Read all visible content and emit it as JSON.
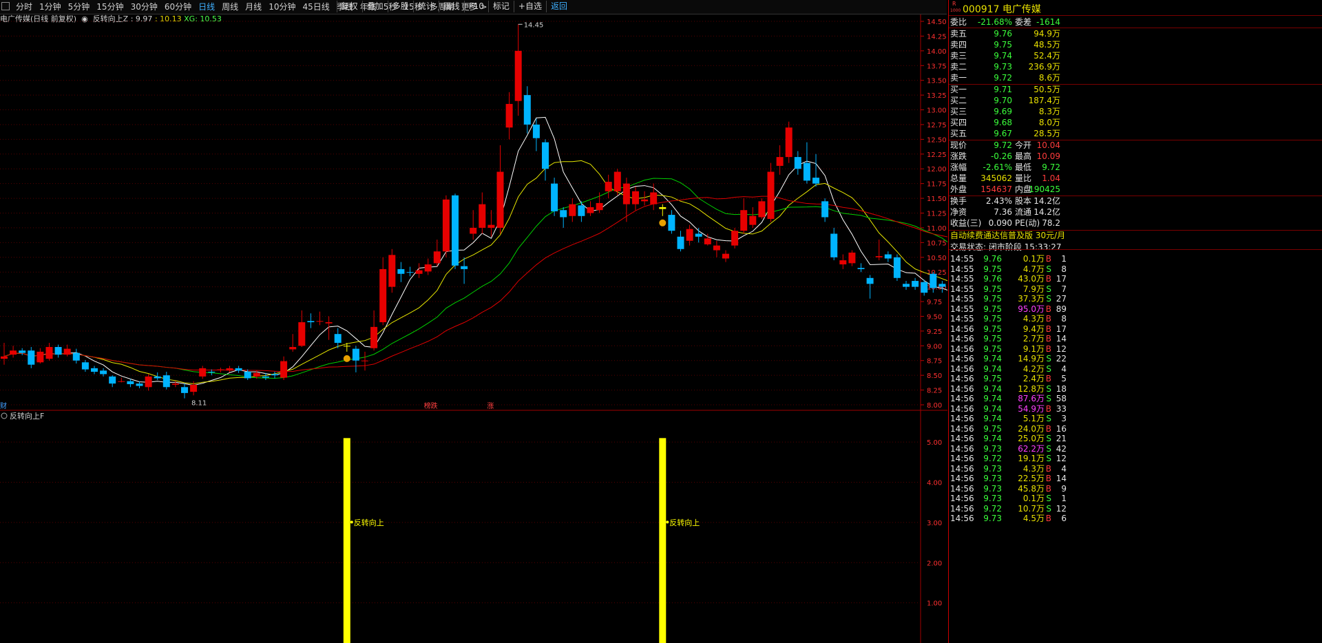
{
  "toolbar": {
    "periods": [
      "分时",
      "1分钟",
      "5分钟",
      "15分钟",
      "30分钟",
      "60分钟",
      "日线",
      "周线",
      "月线",
      "10分钟",
      "45日线",
      "季线",
      "年线",
      "5秒",
      "15秒",
      "多周期",
      "更多 >"
    ],
    "active_period": "日线",
    "tools": [
      "复权",
      "叠加",
      "多股",
      "统计",
      "画线",
      "F10",
      "标记",
      "+自选",
      "返回"
    ],
    "highlight_tool": "返回"
  },
  "indicator_line": {
    "stock": "电广传媒(日线 前复权)",
    "name": "反转向上Z",
    "v1": ": 9.97",
    "v2": ": 10.13",
    "v3": "XG: 10.53"
  },
  "chart": {
    "high_label": "14.45",
    "low_label": "8.11",
    "event_labels": [
      "财",
      "榜跌",
      "涨"
    ],
    "price_ticks": [
      "14.50",
      "14.25",
      "14.00",
      "13.75",
      "13.50",
      "13.25",
      "13.00",
      "12.75",
      "12.50",
      "12.25",
      "12.00",
      "11.75",
      "11.50",
      "11.25",
      "11.00",
      "10.75",
      "10.50",
      "10.25",
      "10.00",
      "9.75",
      "9.50",
      "9.25",
      "9.00",
      "8.75",
      "8.50",
      "8.25",
      "8.00"
    ],
    "sub_name": "反转向上F",
    "sub_ticks": [
      "5.00",
      "4.00",
      "3.00",
      "2.00",
      "1.00"
    ],
    "signal_label": "反转向上",
    "colors": {
      "up": "#e60000",
      "down": "#00b4ff",
      "ma5": "#ffffff",
      "ma10": "#e6e600",
      "ma20": "#00d000",
      "ma30": "#e00000",
      "signal": "#ffff00"
    }
  },
  "quote": {
    "code": "000917",
    "name": "电广传媒",
    "badge": "R",
    "weibi_label": "委比",
    "weibi": "-21.68%",
    "weicha_label": "委差",
    "weicha": "-1614",
    "asks": [
      {
        "label": "卖五",
        "price": "9.76",
        "vol": "94.9万"
      },
      {
        "label": "卖四",
        "price": "9.75",
        "vol": "48.5万"
      },
      {
        "label": "卖三",
        "price": "9.74",
        "vol": "52.4万"
      },
      {
        "label": "卖二",
        "price": "9.73",
        "vol": "236.9万"
      },
      {
        "label": "卖一",
        "price": "9.72",
        "vol": "8.6万"
      }
    ],
    "bids": [
      {
        "label": "买一",
        "price": "9.71",
        "vol": "50.5万"
      },
      {
        "label": "买二",
        "price": "9.70",
        "vol": "187.4万"
      },
      {
        "label": "买三",
        "price": "9.69",
        "vol": "8.3万"
      },
      {
        "label": "买四",
        "price": "9.68",
        "vol": "8.0万"
      },
      {
        "label": "买五",
        "price": "9.67",
        "vol": "28.5万"
      }
    ],
    "stats": [
      {
        "l1": "现价",
        "v1": "9.72",
        "l2": "今开",
        "v2": "10.04"
      },
      {
        "l1": "涨跌",
        "v1": "-0.26",
        "l2": "最高",
        "v2": "10.09"
      },
      {
        "l1": "涨幅",
        "v1": "-2.61%",
        "l2": "最低",
        "v2": "9.72"
      },
      {
        "l1": "总量",
        "v1": "345062",
        "l2": "量比",
        "v2": "1.04"
      },
      {
        "l1": "外盘",
        "v1": "154637",
        "l2": "内盘",
        "v2": "190425"
      }
    ],
    "fund": [
      {
        "l1": "换手",
        "v1": "2.43%",
        "l2": "股本",
        "v2": "14.2亿"
      },
      {
        "l1": "净资",
        "v1": "7.36",
        "l2": "流通",
        "v2": "14.2亿"
      },
      {
        "l1": "收益(三)",
        "v1": "0.090",
        "l2": "PE(动)",
        "v2": "78.2"
      }
    ],
    "ad": "自动续费通达信普及版  30元/月",
    "status": "交易状态: 闭市阶段 15:33:27"
  },
  "ticks": [
    {
      "t": "14:55",
      "p": "9.76",
      "v": "0.1万",
      "s": "B",
      "n": "1"
    },
    {
      "t": "14:55",
      "p": "9.75",
      "v": "4.7万",
      "s": "S",
      "n": "8"
    },
    {
      "t": "14:55",
      "p": "9.76",
      "v": "43.0万",
      "s": "B",
      "n": "17"
    },
    {
      "t": "14:55",
      "p": "9.75",
      "v": "7.9万",
      "s": "S",
      "n": "7"
    },
    {
      "t": "14:55",
      "p": "9.75",
      "v": "37.3万",
      "s": "S",
      "n": "27"
    },
    {
      "t": "14:55",
      "p": "9.75",
      "v": "95.0万",
      "s": "B",
      "n": "89"
    },
    {
      "t": "14:55",
      "p": "9.75",
      "v": "4.3万",
      "s": "B",
      "n": "8"
    },
    {
      "t": "14:56",
      "p": "9.75",
      "v": "9.4万",
      "s": "B",
      "n": "17"
    },
    {
      "t": "14:56",
      "p": "9.75",
      "v": "2.7万",
      "s": "B",
      "n": "14"
    },
    {
      "t": "14:56",
      "p": "9.75",
      "v": "9.1万",
      "s": "B",
      "n": "12"
    },
    {
      "t": "14:56",
      "p": "9.74",
      "v": "14.9万",
      "s": "S",
      "n": "22"
    },
    {
      "t": "14:56",
      "p": "9.74",
      "v": "4.2万",
      "s": "S",
      "n": "4"
    },
    {
      "t": "14:56",
      "p": "9.75",
      "v": "2.4万",
      "s": "B",
      "n": "5"
    },
    {
      "t": "14:56",
      "p": "9.74",
      "v": "12.8万",
      "s": "S",
      "n": "18"
    },
    {
      "t": "14:56",
      "p": "9.74",
      "v": "87.6万",
      "s": "S",
      "n": "58"
    },
    {
      "t": "14:56",
      "p": "9.74",
      "v": "54.9万",
      "s": "B",
      "n": "33"
    },
    {
      "t": "14:56",
      "p": "9.74",
      "v": "5.1万",
      "s": "S",
      "n": "3"
    },
    {
      "t": "14:56",
      "p": "9.75",
      "v": "24.0万",
      "s": "B",
      "n": "16"
    },
    {
      "t": "14:56",
      "p": "9.74",
      "v": "25.0万",
      "s": "S",
      "n": "21"
    },
    {
      "t": "14:56",
      "p": "9.73",
      "v": "62.2万",
      "s": "S",
      "n": "42"
    },
    {
      "t": "14:56",
      "p": "9.72",
      "v": "19.1万",
      "s": "S",
      "n": "12"
    },
    {
      "t": "14:56",
      "p": "9.73",
      "v": "4.3万",
      "s": "B",
      "n": "4"
    },
    {
      "t": "14:56",
      "p": "9.73",
      "v": "22.5万",
      "s": "B",
      "n": "14"
    },
    {
      "t": "14:56",
      "p": "9.73",
      "v": "45.8万",
      "s": "B",
      "n": "9"
    },
    {
      "t": "14:56",
      "p": "9.73",
      "v": "0.1万",
      "s": "S",
      "n": "1"
    },
    {
      "t": "14:56",
      "p": "9.72",
      "v": "10.7万",
      "s": "S",
      "n": "12"
    },
    {
      "t": "14:56",
      "p": "9.73",
      "v": "4.5万",
      "s": "B",
      "n": "6"
    }
  ],
  "chart_data": {
    "type": "candlestick",
    "ylim": [
      8.0,
      14.5
    ],
    "candles": [
      [
        8.78,
        8.82,
        9.05,
        8.68
      ],
      [
        8.85,
        8.92,
        9.0,
        8.8
      ],
      [
        8.92,
        8.88,
        8.96,
        8.84
      ],
      [
        8.92,
        8.68,
        8.98,
        8.62
      ],
      [
        8.72,
        8.9,
        8.96,
        8.7
      ],
      [
        8.78,
        8.98,
        9.05,
        8.75
      ],
      [
        8.98,
        8.85,
        9.02,
        8.8
      ],
      [
        8.85,
        8.95,
        9.02,
        8.82
      ],
      [
        8.88,
        8.75,
        8.95,
        8.7
      ],
      [
        8.72,
        8.6,
        8.76,
        8.56
      ],
      [
        8.62,
        8.56,
        8.66,
        8.52
      ],
      [
        8.58,
        8.52,
        8.62,
        8.48
      ],
      [
        8.48,
        8.36,
        8.5,
        8.3
      ],
      [
        8.4,
        8.4,
        8.46,
        8.38
      ],
      [
        8.4,
        8.35,
        8.44,
        8.3
      ],
      [
        8.36,
        8.32,
        8.4,
        8.28
      ],
      [
        8.3,
        8.48,
        8.52,
        8.24
      ],
      [
        8.48,
        8.45,
        8.55,
        8.42
      ],
      [
        8.5,
        8.3,
        8.56,
        8.26
      ],
      [
        8.34,
        8.36,
        8.4,
        8.3
      ],
      [
        8.3,
        8.2,
        8.36,
        8.11
      ],
      [
        8.22,
        8.34,
        8.4,
        8.16
      ],
      [
        8.48,
        8.62,
        8.66,
        8.44
      ],
      [
        8.56,
        8.55,
        8.6,
        8.5
      ],
      [
        8.6,
        8.6,
        8.63,
        8.55
      ],
      [
        8.58,
        8.62,
        8.66,
        8.55
      ],
      [
        8.62,
        8.58,
        8.66,
        8.54
      ],
      [
        8.56,
        8.45,
        8.6,
        8.42
      ],
      [
        8.48,
        8.54,
        8.58,
        8.44
      ],
      [
        8.48,
        8.46,
        8.54,
        8.42
      ],
      [
        8.52,
        8.5,
        8.56,
        8.45
      ],
      [
        8.46,
        8.74,
        8.82,
        8.42
      ],
      [
        8.94,
        8.98,
        9.2,
        8.9
      ],
      [
        9.0,
        9.4,
        9.6,
        8.98
      ],
      [
        9.42,
        9.4,
        9.55,
        9.3
      ],
      [
        9.42,
        9.42,
        9.58,
        9.35
      ],
      [
        9.38,
        9.4,
        9.5,
        9.1
      ],
      [
        9.2,
        9.05,
        9.3,
        8.96
      ],
      [
        9.0,
        9.0,
        9.05,
        8.9
      ],
      [
        8.95,
        8.75,
        9.0,
        8.55
      ],
      [
        8.75,
        8.75,
        8.9,
        8.58
      ],
      [
        8.96,
        9.32,
        9.6,
        8.92
      ],
      [
        9.4,
        10.3,
        10.5,
        9.35
      ],
      [
        10.0,
        10.54,
        10.64,
        9.9
      ],
      [
        10.3,
        10.22,
        10.42,
        10.08
      ],
      [
        10.25,
        10.24,
        10.34,
        10.18
      ],
      [
        10.22,
        10.28,
        10.4,
        10.15
      ],
      [
        10.26,
        10.38,
        10.48,
        10.2
      ],
      [
        10.4,
        10.6,
        10.8,
        10.35
      ],
      [
        10.6,
        11.48,
        11.55,
        10.5
      ],
      [
        11.55,
        10.36,
        11.58,
        10.3
      ],
      [
        10.35,
        10.3,
        10.5,
        10.05
      ],
      [
        10.9,
        11.0,
        11.3,
        10.8
      ],
      [
        11.0,
        11.4,
        11.6,
        10.9
      ],
      [
        11.0,
        11.05,
        11.3,
        10.85
      ],
      [
        11.0,
        11.95,
        12.4,
        10.9
      ],
      [
        12.7,
        13.1,
        13.3,
        12.5
      ],
      [
        13.15,
        14.0,
        14.45,
        12.9
      ],
      [
        13.25,
        12.75,
        13.4,
        12.6
      ],
      [
        12.75,
        12.52,
        12.85,
        12.3
      ],
      [
        12.45,
        12.0,
        12.5,
        11.8
      ],
      [
        11.75,
        11.28,
        11.85,
        11.2
      ],
      [
        11.3,
        11.18,
        11.35,
        11.0
      ],
      [
        11.2,
        11.4,
        11.5,
        11.1
      ],
      [
        11.38,
        11.2,
        11.45,
        11.1
      ],
      [
        11.25,
        11.35,
        11.45,
        11.2
      ],
      [
        11.3,
        11.42,
        11.6,
        11.25
      ],
      [
        11.62,
        11.78,
        11.9,
        11.5
      ],
      [
        11.62,
        11.95,
        12.0,
        11.55
      ],
      [
        11.4,
        11.75,
        11.85,
        11.1
      ],
      [
        11.4,
        11.62,
        11.7,
        11.3
      ],
      [
        11.45,
        11.48,
        11.62,
        11.38
      ],
      [
        11.4,
        11.6,
        11.75,
        11.3
      ],
      [
        11.35,
        11.32,
        11.4,
        11.2
      ],
      [
        11.22,
        10.95,
        11.3,
        10.9
      ],
      [
        10.85,
        10.64,
        10.95,
        10.6
      ],
      [
        10.78,
        10.98,
        11.05,
        10.7
      ],
      [
        10.9,
        10.85,
        11.0,
        10.75
      ],
      [
        10.72,
        10.82,
        10.9,
        10.7
      ],
      [
        10.62,
        10.7,
        10.78,
        10.5
      ],
      [
        10.48,
        10.56,
        10.62,
        10.42
      ],
      [
        10.7,
        10.95,
        11.0,
        10.65
      ],
      [
        10.95,
        11.3,
        11.5,
        10.9
      ],
      [
        11.05,
        11.2,
        11.35,
        11.0
      ],
      [
        11.18,
        11.45,
        11.5,
        11.15
      ],
      [
        11.15,
        11.95,
        12.1,
        11.1
      ],
      [
        12.05,
        12.2,
        12.4,
        11.9
      ],
      [
        12.2,
        12.7,
        12.8,
        12.1
      ],
      [
        12.2,
        12.0,
        12.3,
        11.9
      ],
      [
        12.1,
        11.8,
        12.45,
        11.75
      ],
      [
        11.85,
        11.75,
        12.25,
        11.7
      ],
      [
        11.45,
        11.18,
        11.5,
        11.1
      ],
      [
        10.9,
        10.5,
        11.0,
        10.45
      ],
      [
        10.38,
        10.45,
        10.55,
        10.3
      ],
      [
        10.4,
        10.58,
        10.62,
        10.35
      ],
      [
        10.32,
        10.3,
        10.4,
        10.25
      ],
      [
        10.15,
        10.05,
        10.2,
        9.8
      ],
      [
        10.5,
        10.52,
        10.8,
        10.45
      ],
      [
        10.55,
        10.48,
        10.6,
        10.42
      ],
      [
        10.5,
        10.15,
        10.55,
        10.1
      ],
      [
        10.05,
        10.0,
        10.1,
        9.95
      ],
      [
        10.1,
        10.0,
        10.15,
        9.95
      ],
      [
        10.08,
        9.9,
        10.12,
        9.85
      ],
      [
        10.22,
        9.98,
        10.25,
        9.9
      ],
      [
        10.05,
        10.0,
        10.1,
        9.9
      ],
      [
        10.04,
        9.72,
        10.09,
        9.72
      ]
    ],
    "signal_days": [
      38,
      73
    ],
    "series": [
      {
        "name": "MA5"
      },
      {
        "name": "MA10"
      },
      {
        "name": "MA20"
      },
      {
        "name": "MA30"
      }
    ]
  }
}
